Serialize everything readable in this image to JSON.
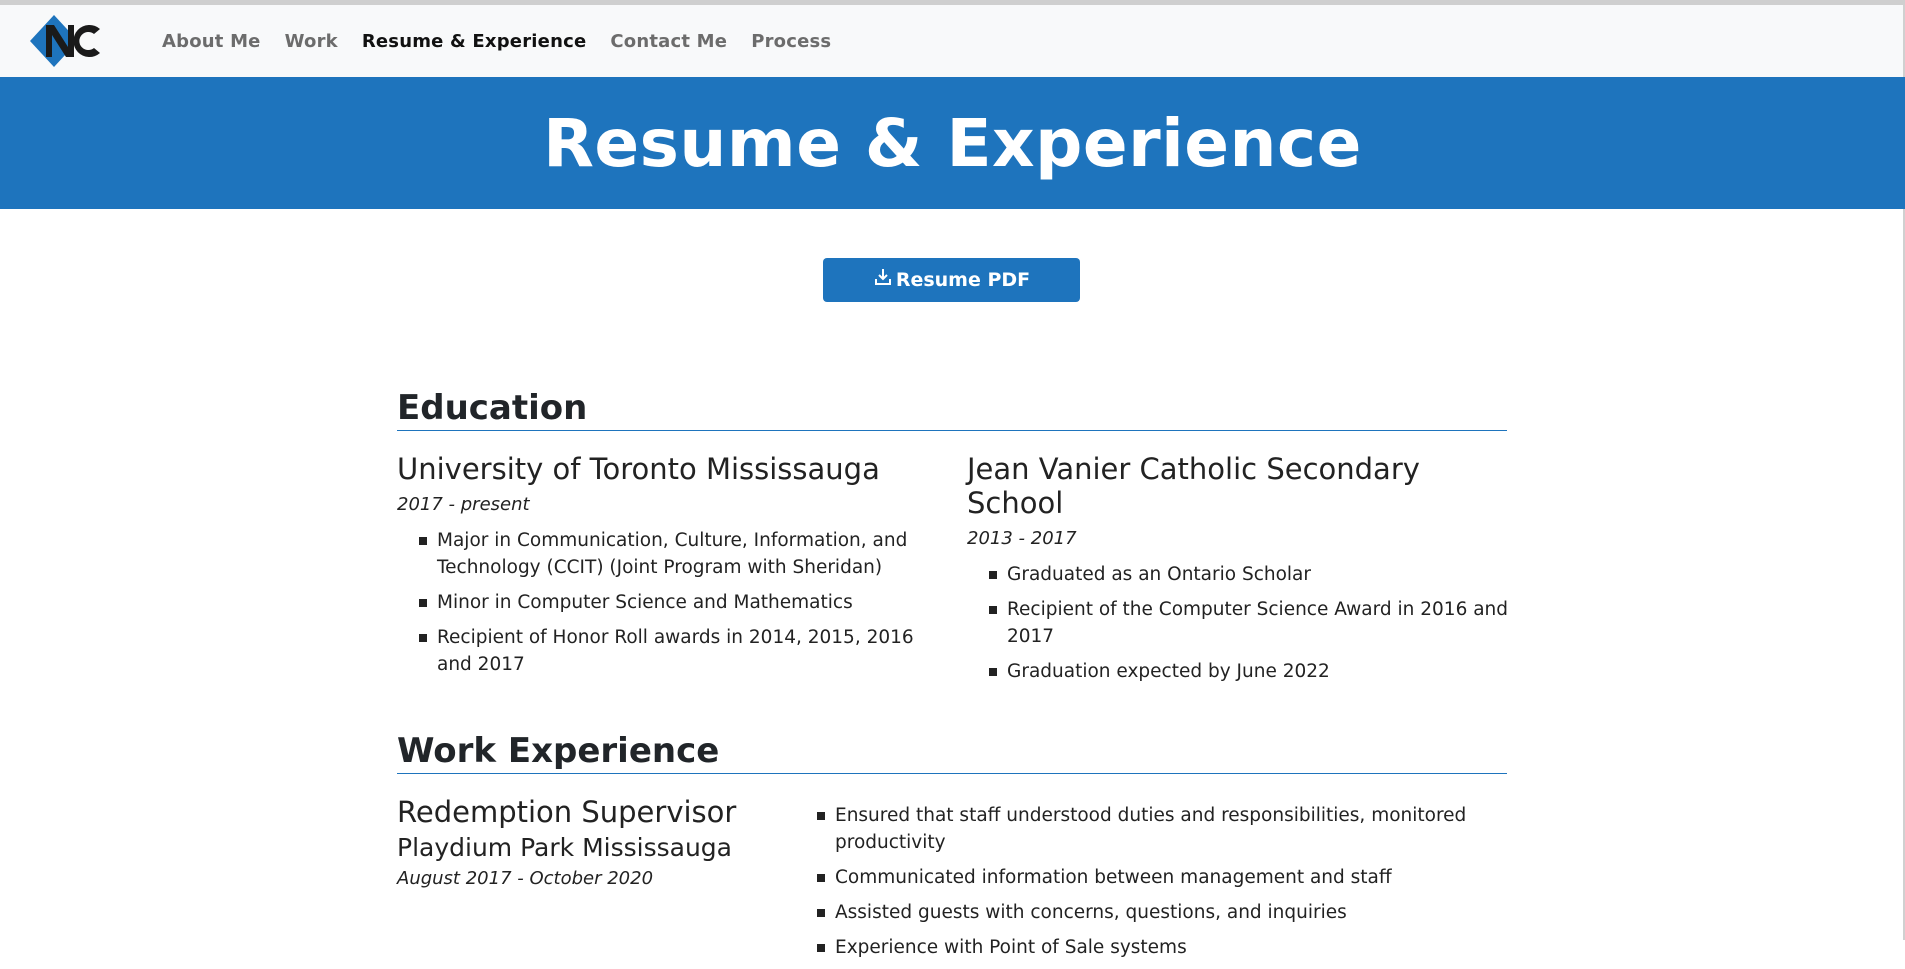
{
  "nav": {
    "logo_icon": "nc-logo-icon",
    "links": [
      "About Me",
      "Work",
      "Resume & Experience",
      "Contact Me",
      "Process"
    ],
    "active": "Resume & Experience"
  },
  "hero": {
    "title": "Resume & Experience"
  },
  "resume_button": {
    "label": "Resume PDF",
    "icon": "download-icon"
  },
  "education": {
    "title": "Education",
    "schools": [
      {
        "name": "University of Toronto Mississauga",
        "dates": "2017 - present",
        "items": [
          "Major in Communication, Culture, Information, and Technology (CCIT) (Joint Program with Sheridan)",
          "Minor in Computer Science and Mathematics",
          "Recipient of Honor Roll awards in 2014, 2015, 2016 and 2017"
        ]
      },
      {
        "name": "Jean Vanier Catholic Secondary School",
        "dates": "2013 - 2017",
        "items": [
          "Graduated as an Ontario Scholar",
          "Recipient of the Computer Science Award in 2016 and 2017",
          "Graduation expected by June 2022"
        ]
      }
    ]
  },
  "work": {
    "title": "Work Experience",
    "jobs": [
      {
        "title": "Redemption Supervisor",
        "company": "Playdium Park Mississauga",
        "dates": "August 2017 - October 2020",
        "items": [
          "Ensured that staff understood duties and responsibilities, monitored productivity",
          "Communicated information between management and staff",
          "Assisted guests with concerns, questions, and inquiries",
          "Experience with Point of Sale systems"
        ]
      }
    ]
  },
  "colors": {
    "accent": "#1e74bd",
    "nav_bg": "#f8f9fa"
  }
}
